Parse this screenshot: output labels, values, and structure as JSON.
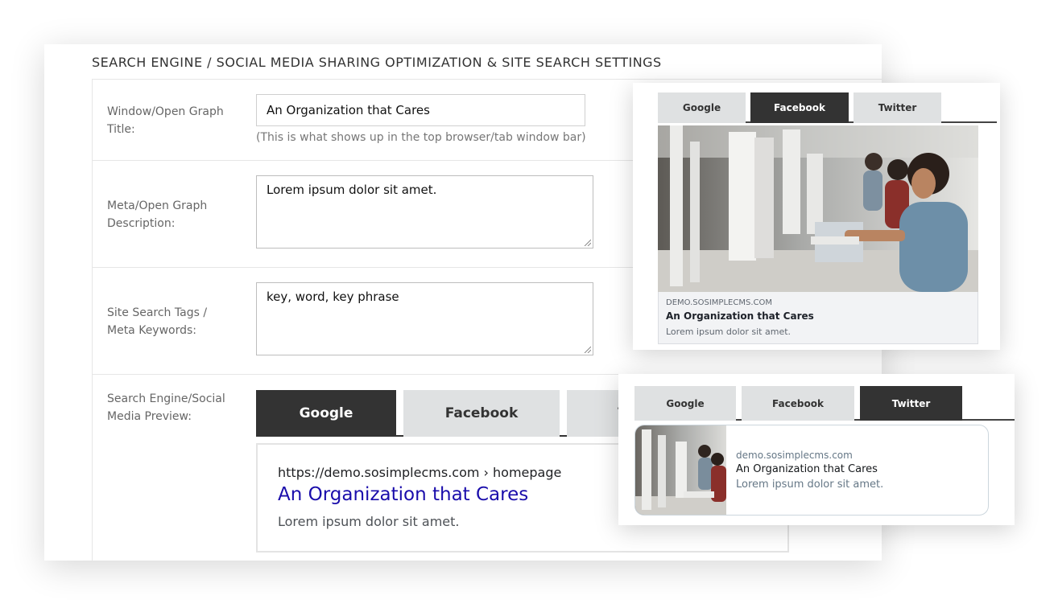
{
  "panel": {
    "title": "SEARCH ENGINE / SOCIAL MEDIA SHARING OPTIMIZATION & SITE SEARCH SETTINGS"
  },
  "fields": {
    "title_label": "Window/Open Graph Title:",
    "title_value": "An Organization that Cares",
    "title_hint": "(This is what shows up in the top browser/tab window bar)",
    "description_label": "Meta/Open Graph Description:",
    "description_value": "Lorem ipsum dolor sit amet.",
    "keywords_label": "Site Search Tags / Meta Keywords:",
    "keywords_value": "key, word, key phrase",
    "preview_label": "Search Engine/Social Media Preview:"
  },
  "preview_tabs": [
    {
      "label": "Google"
    },
    {
      "label": "Facebook"
    },
    {
      "label": "Twitter"
    }
  ],
  "preview_active_tab": "Google",
  "google_preview": {
    "url": "https://demo.sosimplecms.com › homepage",
    "title": "An Organization that Cares",
    "description": "Lorem ipsum dolor sit amet."
  },
  "facebook_card": {
    "tabs": [
      {
        "label": "Google"
      },
      {
        "label": "Facebook"
      },
      {
        "label": "Twitter"
      }
    ],
    "active_tab": "Facebook",
    "domain": "DEMO.SOSIMPLECMS.COM",
    "title": "An Organization that Cares",
    "description": "Lorem ipsum dolor sit amet."
  },
  "twitter_card": {
    "tabs": [
      {
        "label": "Google"
      },
      {
        "label": "Facebook"
      },
      {
        "label": "Twitter"
      }
    ],
    "active_tab": "Twitter",
    "domain": "demo.sosimplecms.com",
    "title": "An Organization that Cares",
    "description": "Lorem ipsum dolor sit amet."
  },
  "colors": {
    "active_tab": "#333333",
    "inactive_tab": "#dfe1e2",
    "google_link": "#1a0dab",
    "facebook_meta_bg": "#f2f3f5"
  },
  "icons": {
    "resize_handle": "resize-grip-icon"
  }
}
